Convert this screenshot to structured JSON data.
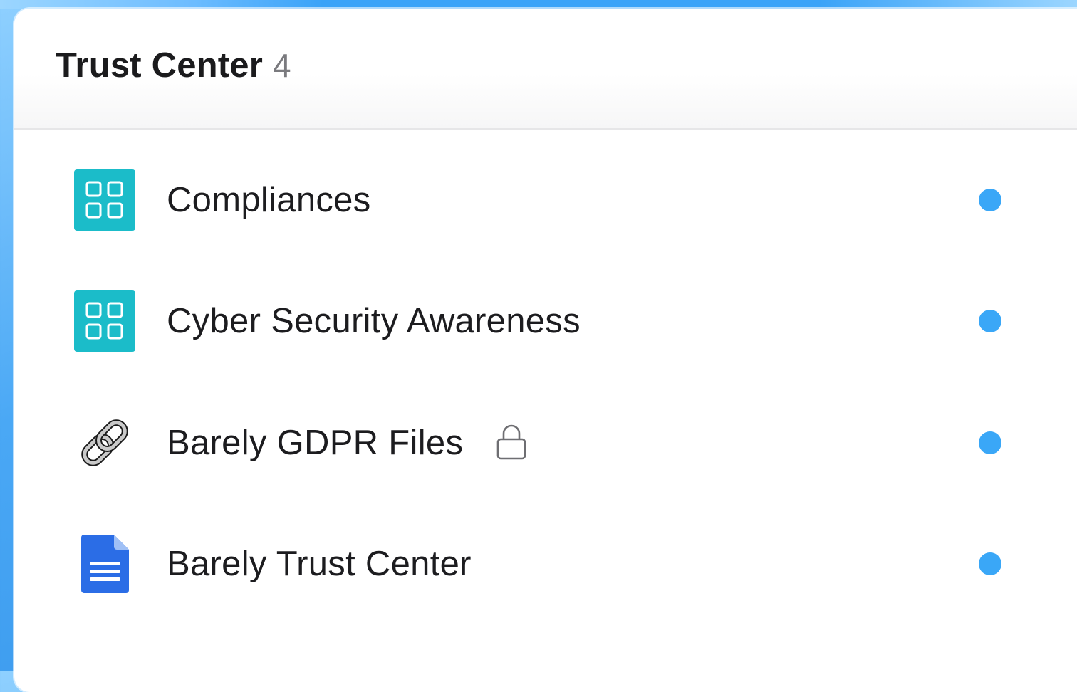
{
  "panel": {
    "title": "Trust Center",
    "count": "4"
  },
  "items": [
    {
      "label": "Compliances",
      "icon": "grid-icon",
      "icon_bg": "#1bbcc9",
      "locked": false,
      "status_color": "#3aa7f7"
    },
    {
      "label": "Cyber Security Awareness",
      "icon": "grid-icon",
      "icon_bg": "#1bbcc9",
      "locked": false,
      "status_color": "#3aa7f7"
    },
    {
      "label": "Barely GDPR Files",
      "icon": "link-chain-icon",
      "locked": true,
      "status_color": "#3aa7f7"
    },
    {
      "label": "Barely Trust Center",
      "icon": "google-doc-icon",
      "icon_bg": "#2b6de6",
      "locked": false,
      "status_color": "#3aa7f7"
    }
  ]
}
